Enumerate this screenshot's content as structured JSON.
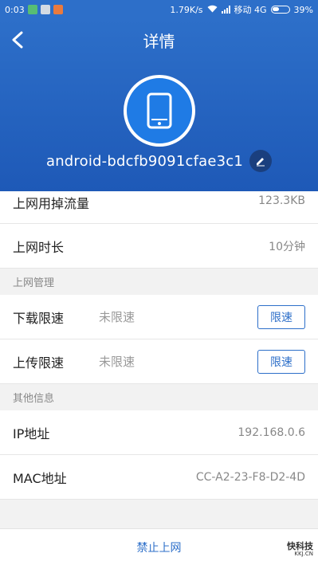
{
  "status_bar": {
    "time": "0:03",
    "speed": "1.79K/s",
    "carrier": "移动 4G",
    "battery": "39%"
  },
  "header": {
    "title": "详情",
    "device_name": "android-bdcfb9091cfae3c1"
  },
  "rows": {
    "traffic_label": "上网用掉流量",
    "traffic_value": "123.3KB",
    "duration_label": "上网时长",
    "duration_value": "10分钟"
  },
  "manage_section": {
    "title": "上网管理",
    "download_label": "下载限速",
    "download_status": "未限速",
    "download_button": "限速",
    "upload_label": "上传限速",
    "upload_status": "未限速",
    "upload_button": "限速"
  },
  "info_section": {
    "title": "其他信息",
    "ip_label": "IP地址",
    "ip_value": "192.168.0.6",
    "mac_label": "MAC地址",
    "mac_value": "CC-A2-23-F8-D2-4D"
  },
  "bottom": {
    "ban_label": "禁止上网"
  },
  "watermark": {
    "main": "快科技",
    "sub": "KKJ.CN"
  },
  "colors": {
    "primary": "#2d6fc9",
    "header_dark": "#1e59b7"
  }
}
